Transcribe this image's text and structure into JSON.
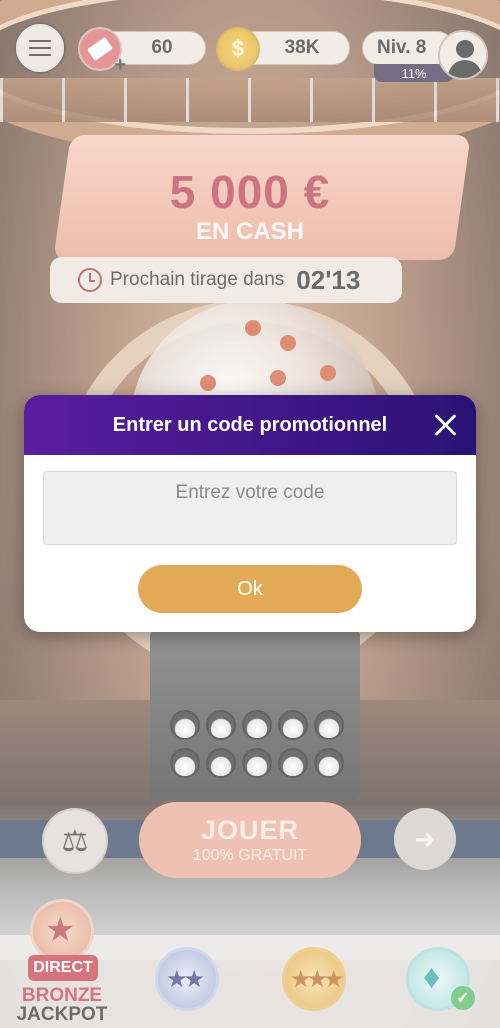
{
  "header": {
    "tickets_count": "60",
    "coins_count": "38K",
    "level_label": "Niv. 8",
    "level_progress": "11%"
  },
  "jackpot": {
    "amount": "5 000 €",
    "subtitle": "EN CASH",
    "next_draw_label": "Prochain tirage dans",
    "next_draw_time": "02'13"
  },
  "promo_modal": {
    "title": "Entrer un code promotionnel",
    "input_placeholder": "Entrez votre code",
    "input_value": "",
    "ok_label": "Ok"
  },
  "actions": {
    "play_label": "JOUER",
    "play_sublabel": "100% GRATUIT"
  },
  "tabs": {
    "direct_badge": "DIRECT",
    "bronze_label": "BRONZE",
    "jackpot_label": "JACKPOT"
  },
  "icons": [
    "menu-icon",
    "ticket-icon",
    "coin-icon",
    "avatar-icon",
    "clock-icon",
    "close-icon",
    "scale-icon",
    "next-arrow-icon",
    "star-icon",
    "two-stars-icon",
    "three-stars-icon",
    "diamond-icon",
    "check-icon"
  ],
  "colors": {
    "modal_header": "#4a1a8e",
    "ok_button": "#e2aa56",
    "jackpot_amount": "#b4283d",
    "direct_badge": "#c02a3a"
  }
}
